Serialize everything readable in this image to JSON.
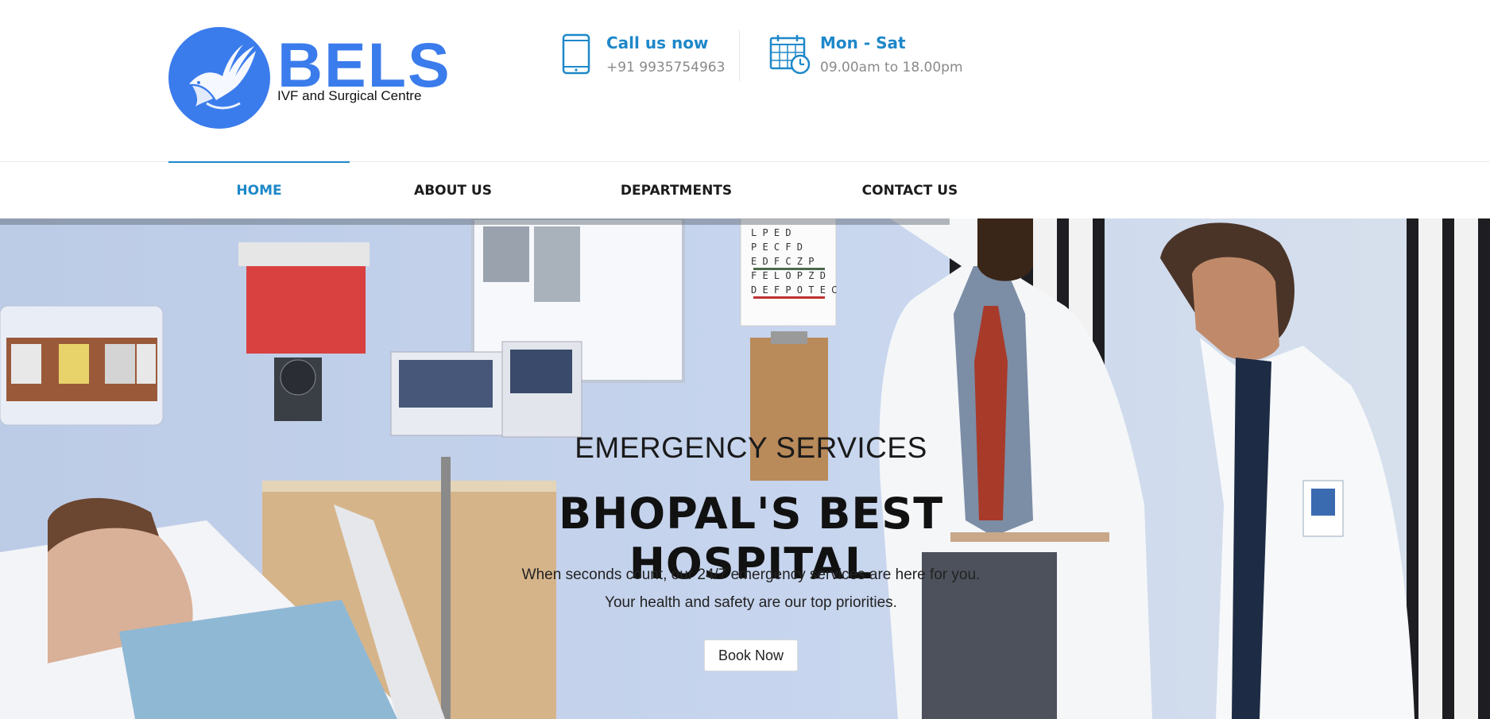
{
  "brand": {
    "name": "BELS",
    "tagline": "IVF and Surgical Centre",
    "color": "#3b7cec"
  },
  "contact": {
    "call_title": "Call us now",
    "phone": "+91 9935754963",
    "hours_title": "Mon - Sat",
    "hours": "09.00am to 18.00pm",
    "icons": [
      "tablet-icon",
      "calendar-clock-icon"
    ]
  },
  "nav": {
    "items": [
      {
        "label": "HOME",
        "active": true
      },
      {
        "label": "ABOUT US",
        "active": false
      },
      {
        "label": "DEPARTMENTS",
        "active": false
      },
      {
        "label": "CONTACT US",
        "active": false
      }
    ],
    "accent": "#1e88c9"
  },
  "hero": {
    "kicker": "EMERGENCY SERVICES",
    "title": "BHOPAL'S BEST HOSPITAL",
    "line1": "When seconds count, our 24/7 emergency services are here for you.",
    "line2": "Your health and safety are our top priorities.",
    "button": "Book Now"
  }
}
